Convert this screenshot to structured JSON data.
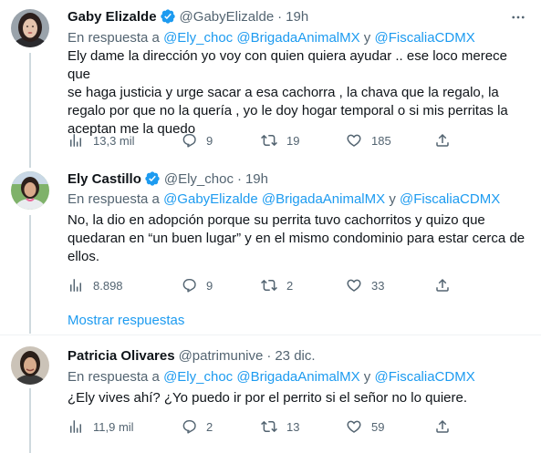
{
  "reply_prefix": "En respuesta a",
  "and_word": "y",
  "tweets": [
    {
      "name": "Gaby Elizalde",
      "verified": true,
      "handle": "@GabyElizalde",
      "time": "19h",
      "mentions": [
        "@Ely_choc",
        "@BrigadaAnimalMX",
        "@FiscaliaCDMX"
      ],
      "lines": [
        "Ely dame la dirección yo voy con quien quiera ayudar .. ese loco merece que",
        "se haga justicia y urge sacar a esa cachorra , la chava que la regalo, la",
        "regalo por que no la quería , yo le doy hogar temporal o si mis perritas la",
        "aceptan me la quedo"
      ],
      "views": "13,3 mil",
      "replies": "9",
      "retweets": "19",
      "likes": "185"
    },
    {
      "name": "Ely Castillo",
      "verified": true,
      "handle": "@Ely_choc",
      "time": "19h",
      "mentions": [
        "@GabyElizalde",
        "@BrigadaAnimalMX",
        "@FiscaliaCDMX"
      ],
      "lines": [
        "No, la dio en adopción porque su perrita tuvo cachorritos y quizo que",
        "quedaran en “un buen lugar” y en el mismo condominio para estar cerca de",
        "ellos."
      ],
      "views": "8.898",
      "replies": "9",
      "retweets": "2",
      "likes": "33"
    },
    {
      "name": "Patricia Olivares",
      "verified": false,
      "handle": "@patrimunive",
      "time": "23 dic.",
      "mentions": [
        "@Ely_choc",
        "@BrigadaAnimalMX",
        "@FiscaliaCDMX"
      ],
      "lines": [
        "¿Ely vives ahí? ¿Yo puedo ir por el perrito si el señor no lo quiere."
      ],
      "views": "11,9 mil",
      "replies": "2",
      "retweets": "13",
      "likes": "59"
    }
  ],
  "show_replies_label": "Mostrar respuestas",
  "colors": {
    "accent": "#1d9bf0",
    "secondary_text": "#536471",
    "primary_text": "#0f1419",
    "divider": "#eff3f4"
  },
  "icons": {
    "verified": "verified-badge-icon",
    "more": "more-options-icon",
    "views": "analytics-icon",
    "reply": "reply-icon",
    "retweet": "retweet-icon",
    "like": "heart-icon",
    "share": "share-icon"
  }
}
